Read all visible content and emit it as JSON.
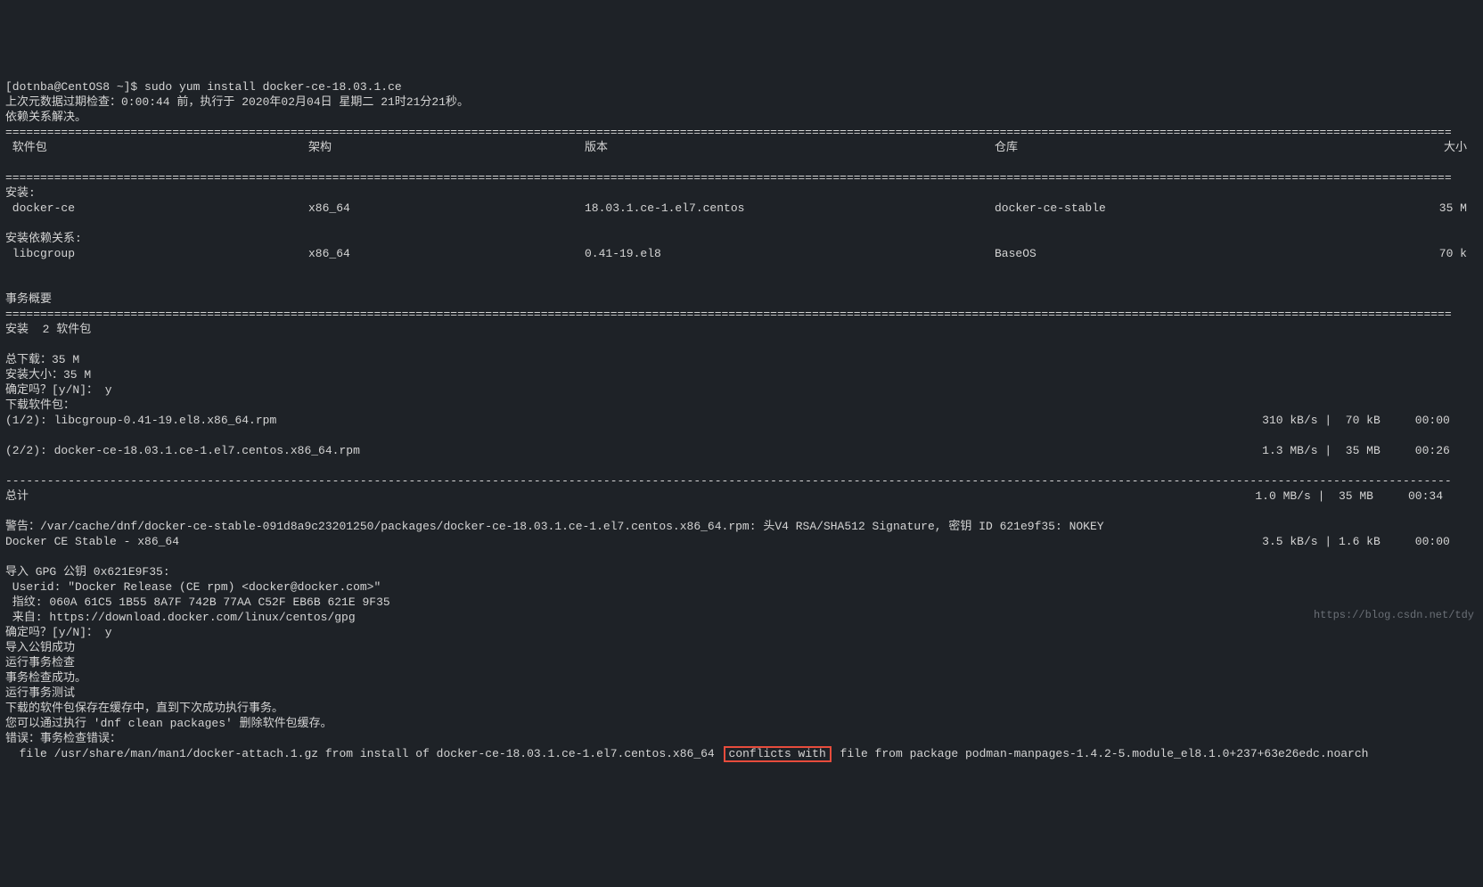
{
  "prompt": "[dotnba@CentOS8 ~]$ ",
  "command": "sudo yum install docker-ce-18.03.1.ce",
  "metadata_line": "上次元数据过期检查：0:00:44 前，执行于 2020年02月04日 星期二 21时21分21秒。",
  "deps_resolved": "依赖关系解决。",
  "divider": "================================================================================================================================================================================================================",
  "dash_divider": "----------------------------------------------------------------------------------------------------------------------------------------------------------------------------------------------------------------",
  "headers": {
    "package": " 软件包",
    "arch": "架构",
    "version": "版本",
    "repo": "仓库",
    "size": "大小"
  },
  "install_label": "安装:",
  "rows": [
    {
      "pkg": " docker-ce",
      "arch": "x86_64",
      "ver": "18.03.1.ce-1.el7.centos",
      "repo": "docker-ce-stable",
      "size": "35 M"
    }
  ],
  "install_deps_label": "安装依赖关系:",
  "dep_rows": [
    {
      "pkg": " libcgroup",
      "arch": "x86_64",
      "ver": "0.41-19.el8",
      "repo": "BaseOS",
      "size": "70 k"
    }
  ],
  "summary_label": "事务概要",
  "install_count": "安装  2 软件包",
  "total_dl": "总下载：35 M",
  "install_size": "安装大小：35 M",
  "confirm1": "确定吗？[y/N]： y",
  "dl_label": "下载软件包：",
  "downloads": [
    {
      "left": "(1/2): libcgroup-0.41-19.el8.x86_64.rpm",
      "right": "310 kB/s |  70 kB     00:00    "
    },
    {
      "left": "(2/2): docker-ce-18.03.1.ce-1.el7.centos.x86_64.rpm",
      "right": "1.3 MB/s |  35 MB     00:26    "
    }
  ],
  "total_label": "总计",
  "total_right": "1.0 MB/s |  35 MB     00:34     ",
  "warning": "警告：/var/cache/dnf/docker-ce-stable-091d8a9c23201250/packages/docker-ce-18.03.1.ce-1.el7.centos.x86_64.rpm: 头V4 RSA/SHA512 Signature, 密钥 ID 621e9f35: NOKEY",
  "stable_line": "Docker CE Stable - x86_64",
  "stable_right": "3.5 kB/s | 1.6 kB     00:00    ",
  "import_gpg": "导入 GPG 公钥 0x621E9F35:",
  "userid": " Userid: \"Docker Release (CE rpm) <docker@docker.com>\"",
  "fingerprint": " 指纹: 060A 61C5 1B55 8A7F 742B 77AA C52F EB6B 621E 9F35",
  "from": " 来自: https://download.docker.com/linux/centos/gpg",
  "confirm2": "确定吗？[y/N]： y",
  "import_ok": "导入公钥成功",
  "run_check": "运行事务检查",
  "check_ok": "事务检查成功。",
  "run_test": "运行事务测试",
  "cache_line": "下载的软件包保存在缓存中，直到下次成功执行事务。",
  "clean_line": "您可以通过执行 'dnf clean packages' 删除软件包缓存。",
  "error_label": "错误：事务检查错误：",
  "conflict_pre": "  file /usr/share/man/man1/docker-attach.1.gz from install of docker-ce-18.03.1.ce-1.el7.centos.x86_64 ",
  "conflict_mid": "conflicts with",
  "conflict_post": " file from package podman-manpages-1.4.2-5.module_el8.1.0+237+63e26edc.noarch",
  "watermark": "https://blog.csdn.net/tdy"
}
